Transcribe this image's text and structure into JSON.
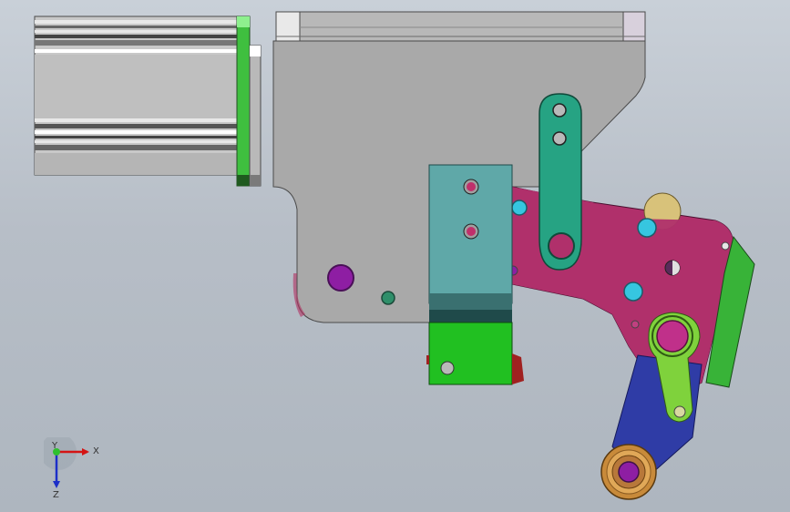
{
  "triad": {
    "x_label": "X",
    "y_label": "Y",
    "z_label": "Z"
  },
  "colors": {
    "background_top": "#c9d0d8",
    "background_bottom": "#aeb6bf",
    "housing_plate": "#a9a9a9",
    "motor_body": "#c8c8c8",
    "green_flange": "#3fbf3f",
    "teal_block": "#5fa8a8",
    "green_block": "#21c021",
    "magenta_plate": "#b0306b",
    "teal_link": "#26a383",
    "lime_arm": "#7fd23c",
    "blue_arm": "#2f3ca6",
    "green_side_plate": "#38b338",
    "bronze_bearing": "#c88a3a",
    "purple_pin": "#8e1ea3",
    "cyan_screw": "#36c6e0"
  }
}
